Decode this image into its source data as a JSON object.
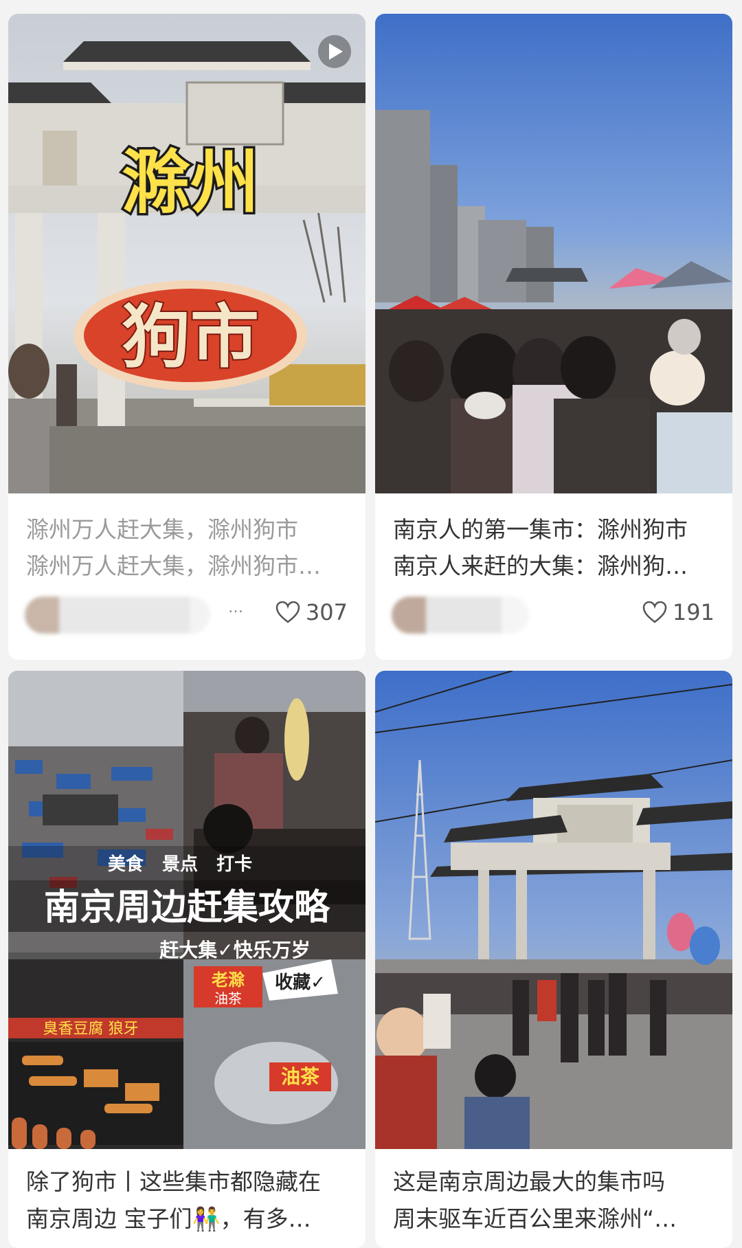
{
  "posts": [
    {
      "overlay_line1": "滁州",
      "overlay_line2": "狗市",
      "caption_line1": "滁州万人赶大集，滁州狗市",
      "caption_line2": "滁州万人赶大集，滁州狗市…",
      "author_more": "…",
      "likes": "307",
      "is_video": true
    },
    {
      "caption_line1": "南京人的第一集市：滁州狗市",
      "caption_line2": "南京人来赶的大集：滁州狗…",
      "likes": "191"
    },
    {
      "overlay_tags": "美食   景点   打卡",
      "overlay_title": "南京周边赶集攻略",
      "overlay_sub": "赶大集✓快乐万岁",
      "sign_tofu": "臭香豆腐 狼牙",
      "sign_laoman": "老滁",
      "sign_youcha_small": "油茶",
      "sticker_collect": "收藏✓",
      "sign_youcha": "油茶",
      "caption_line1": "除了狗市丨这些集市都隐藏在",
      "caption_line2": "南京周边 宝子们👫，有多…"
    },
    {
      "caption_line1": "这是南京周边最大的集市吗",
      "caption_line2": "周末驱车近百公里来滁州“…"
    }
  ],
  "colors": {
    "caption_gray": "#9a9a9a",
    "caption_dark": "#333333",
    "overlay_yellow": "#ffe14a",
    "overlay_red": "#e8462a"
  }
}
